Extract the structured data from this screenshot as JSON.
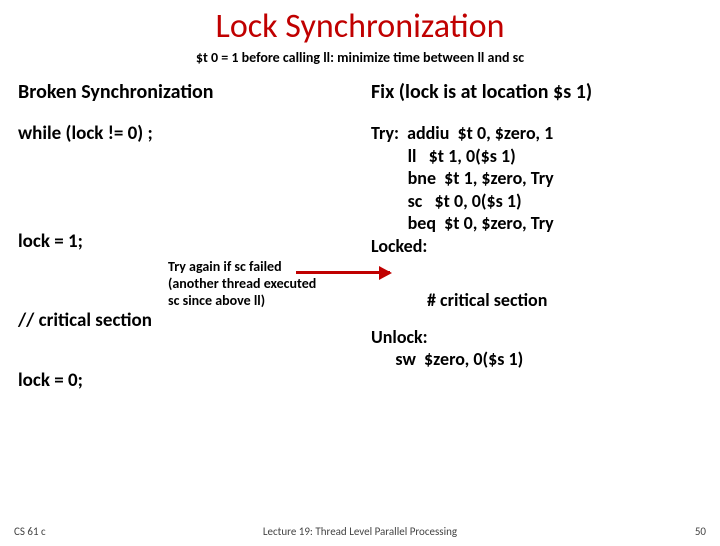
{
  "title": "Lock Synchronization",
  "subtitle_prefix": "$t 0 = 1 before calling ",
  "subtitle_ll": "ll",
  "subtitle_mid": ": minimize time between ",
  "subtitle_ll2": "ll",
  "subtitle_and": " and ",
  "subtitle_sc": "sc",
  "left": {
    "heading": "Broken Synchronization",
    "while": "while (lock != 0) ;",
    "lock1": "lock = 1;",
    "crit": "// critical section",
    "lock0": "lock = 0;"
  },
  "note": {
    "l1a": "Try again if ",
    "l1b": "sc",
    "l1c": " failed",
    "l2": "(another thread executed",
    "l3a": "sc",
    "l3b": " since above ",
    "l3c": "ll",
    "l3d": ")"
  },
  "right": {
    "heading": "Fix (lock is at location $s 1)",
    "try": "Try:  addiu  $t 0, $zero, 1\n         ll   $t 1, 0($s 1)\n         bne  $t 1, $zero, Try\n         sc   $t 0, 0($s 1)\n         beq  $t 0, $zero, Try\nLocked:",
    "crit": "# critical section",
    "unlock": "Unlock:\n      sw  $zero, 0($s 1)"
  },
  "footer": {
    "left": "CS 61 c",
    "center": "Lecture 19: Thread Level Parallel Processing",
    "right": "50"
  }
}
